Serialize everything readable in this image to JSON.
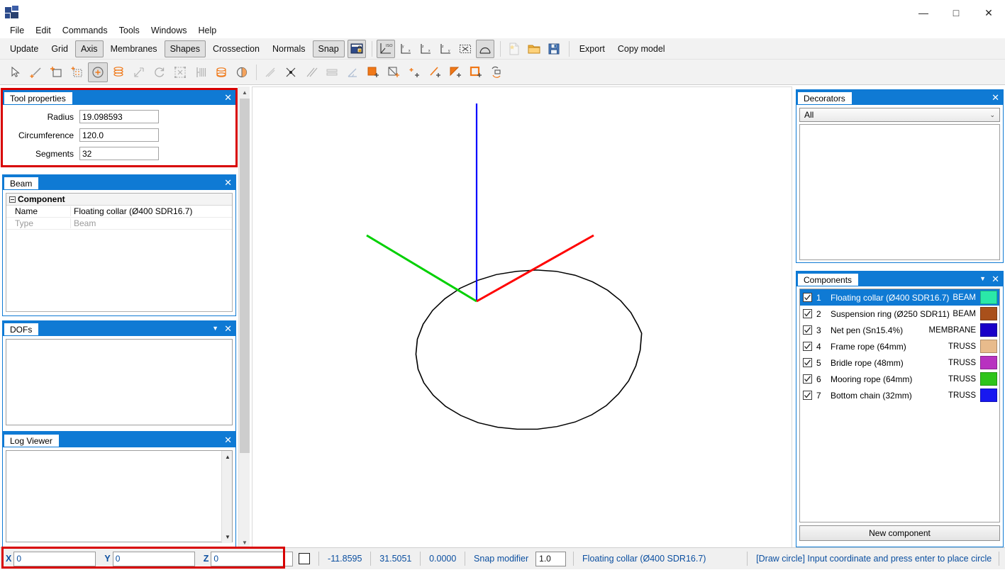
{
  "window": {
    "title": "",
    "app_icon": "app-icon",
    "controls": {
      "minimize": "—",
      "maximize": "□",
      "close": "✕"
    }
  },
  "menubar": {
    "items": [
      "File",
      "Edit",
      "Commands",
      "Tools",
      "Windows",
      "Help"
    ]
  },
  "toolbar_main": {
    "buttons": [
      {
        "label": "Update",
        "toggled": false
      },
      {
        "label": "Grid",
        "toggled": false
      },
      {
        "label": "Axis",
        "toggled": true
      },
      {
        "label": "Membranes",
        "toggled": false
      },
      {
        "label": "Shapes",
        "toggled": true
      },
      {
        "label": "Crossection",
        "toggled": false
      },
      {
        "label": "Normals",
        "toggled": false
      },
      {
        "label": "Snap",
        "toggled": true
      }
    ],
    "icons": [
      {
        "name": "lock-view-icon",
        "toggled": true,
        "dim": false
      },
      {
        "name": "iso-view-icon",
        "toggled": true,
        "dim": false
      },
      {
        "name": "view-yx-icon",
        "toggled": false,
        "dim": false
      },
      {
        "name": "view-zx-icon",
        "toggled": false,
        "dim": false
      },
      {
        "name": "view-zy-icon",
        "toggled": false,
        "dim": false
      },
      {
        "name": "zoom-selection-icon",
        "toggled": false,
        "dim": false
      },
      {
        "name": "shapes-toggle-icon",
        "toggled": true,
        "dim": false
      },
      {
        "name": "new-file-icon",
        "toggled": false,
        "dim": true
      },
      {
        "name": "open-folder-icon",
        "toggled": false,
        "dim": false
      },
      {
        "name": "save-disk-icon",
        "toggled": false,
        "dim": false
      }
    ],
    "text_buttons_right": [
      "Export",
      "Copy model"
    ]
  },
  "toolbar_tools": {
    "icons": [
      {
        "name": "select-arrow-icon",
        "toggled": false,
        "dim": false
      },
      {
        "name": "draw-line-icon",
        "toggled": false,
        "dim": false
      },
      {
        "name": "draw-rectangle-icon",
        "toggled": false,
        "dim": false
      },
      {
        "name": "draw-grid-icon",
        "toggled": false,
        "dim": false
      },
      {
        "name": "draw-circle-icon",
        "toggled": true,
        "dim": false
      },
      {
        "name": "extrude-icon",
        "toggled": false,
        "dim": false
      },
      {
        "name": "move-icon",
        "toggled": false,
        "dim": true
      },
      {
        "name": "rotate-icon",
        "toggled": false,
        "dim": true
      },
      {
        "name": "scale-icon",
        "toggled": false,
        "dim": true
      },
      {
        "name": "mirror-icon",
        "toggled": false,
        "dim": true
      },
      {
        "name": "revolve-icon",
        "toggled": false,
        "dim": false
      },
      {
        "name": "half-circle-icon",
        "toggled": false,
        "dim": false
      },
      {
        "name": "diagonal-line-icon",
        "toggled": false,
        "dim": true
      },
      {
        "name": "intersection-icon",
        "toggled": false,
        "dim": true
      },
      {
        "name": "parallel-lines-icon",
        "toggled": false,
        "dim": true
      },
      {
        "name": "offset-icon",
        "toggled": false,
        "dim": true
      },
      {
        "name": "angle-icon",
        "toggled": false,
        "dim": true
      },
      {
        "name": "fill-surface-icon",
        "toggled": false,
        "dim": false
      },
      {
        "name": "surface-point-icon",
        "toggled": false,
        "dim": false
      },
      {
        "name": "add-point-icon",
        "toggled": false,
        "dim": false
      },
      {
        "name": "add-line-icon",
        "toggled": false,
        "dim": false
      },
      {
        "name": "add-triangle-icon",
        "toggled": false,
        "dim": false
      },
      {
        "name": "add-square-icon",
        "toggled": false,
        "dim": false
      },
      {
        "name": "add-revolve-icon",
        "toggled": false,
        "dim": false
      }
    ]
  },
  "tool_properties": {
    "title": "Tool properties",
    "close": "✕",
    "highlighted": true,
    "fields": [
      {
        "label": "Radius",
        "value": "19.098593"
      },
      {
        "label": "Circumference",
        "value": "120.0"
      },
      {
        "label": "Segments",
        "value": "32"
      }
    ]
  },
  "beam": {
    "title": "Beam",
    "close": "✕",
    "group_label": "Component",
    "rows": [
      {
        "key": "Name",
        "value": "Floating collar (Ø400 SDR16.7)",
        "dim": false
      },
      {
        "key": "Type",
        "value": "Beam",
        "dim": true
      }
    ]
  },
  "dofs": {
    "title": "DOFs",
    "close": "✕",
    "dropdown": "▼"
  },
  "log_viewer": {
    "title": "Log Viewer",
    "close": "✕"
  },
  "decorators": {
    "title": "Decorators",
    "close": "✕",
    "filter_value": "All",
    "caret": "⌄",
    "items": []
  },
  "components": {
    "title": "Components",
    "close": "✕",
    "dropdown": "▼",
    "new_button": "New component",
    "rows": [
      {
        "index": "1",
        "checked": true,
        "name": "Floating collar (Ø400 SDR16.7)",
        "type": "BEAM",
        "color": "#2ae8a8",
        "selected": true
      },
      {
        "index": "2",
        "checked": true,
        "name": "Suspension ring (Ø250 SDR11)",
        "type": "BEAM",
        "color": "#a9501b",
        "selected": false
      },
      {
        "index": "3",
        "checked": true,
        "name": "Net pen (Sn15.4%)",
        "type": "MEMBRANE",
        "color": "#1a00c8",
        "selected": false
      },
      {
        "index": "4",
        "checked": true,
        "name": "Frame rope (64mm)",
        "type": "TRUSS",
        "color": "#e8bb8c",
        "selected": false
      },
      {
        "index": "5",
        "checked": true,
        "name": "Bridle rope (48mm)",
        "type": "TRUSS",
        "color": "#b832c0",
        "selected": false
      },
      {
        "index": "6",
        "checked": true,
        "name": "Mooring rope (64mm)",
        "type": "TRUSS",
        "color": "#2ec41a",
        "selected": false
      },
      {
        "index": "7",
        "checked": true,
        "name": "Bottom chain (32mm)",
        "type": "TRUSS",
        "color": "#1818f0",
        "selected": false
      }
    ]
  },
  "viewport": {
    "name": "3d-model-viewport",
    "circle_color": "#000000",
    "axis_x_color": "#ff0000",
    "axis_y_color": "#00d000",
    "axis_z_color": "#0000ff"
  },
  "statusbar": {
    "highlighted": true,
    "coords": [
      {
        "label": "X",
        "value": "0"
      },
      {
        "label": "Y",
        "value": "0"
      },
      {
        "label": "Z",
        "value": "0"
      }
    ],
    "readouts": [
      "-11.8595",
      "31.5051",
      "0.0000"
    ],
    "snap_modifier_label": "Snap modifier",
    "snap_modifier_value": "1.0",
    "active_component": "Floating collar (Ø400 SDR16.7)",
    "hint": "[Draw circle] Input coordinate and press enter to place circle"
  }
}
